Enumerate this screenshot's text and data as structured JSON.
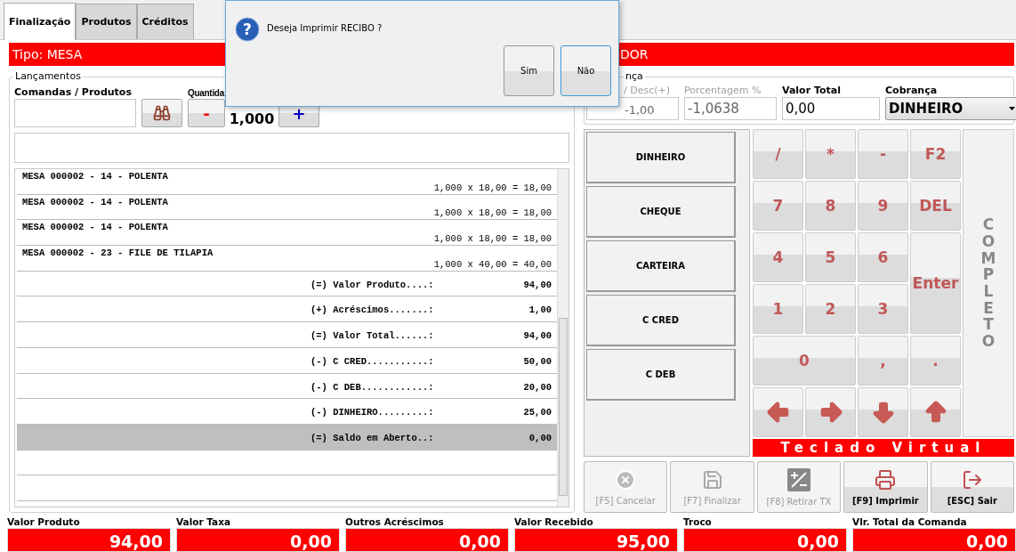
{
  "tabs": [
    {
      "label": "Finalização",
      "selected": true
    },
    {
      "label": "Produtos",
      "selected": false
    },
    {
      "label": "Créditos",
      "selected": false
    }
  ],
  "header": {
    "left": "Tipo: MESA",
    "right": "DOR"
  },
  "launch": {
    "title": "Lançamentos",
    "product_label": "Comandas / Produtos",
    "quantity_label": "Quantida",
    "minus": "-",
    "quantity": "1,000",
    "plus": "+"
  },
  "entries": [
    {
      "kind": "item",
      "title": "MESA 000002 - 14 - POLENTA",
      "calc": "1,000 x 18,00 = 18,00",
      "selected": false
    },
    {
      "kind": "item",
      "title": "MESA 000002 - 14 - POLENTA",
      "calc": "1,000 x 18,00 = 18,00",
      "selected": false
    },
    {
      "kind": "item",
      "title": "MESA 000002 - 14 - POLENTA",
      "calc": "1,000 x 18,00 = 18,00",
      "selected": false
    },
    {
      "kind": "item",
      "title": "MESA 000002 - 23 - FILE DE TILAPIA",
      "calc": "1,000 x 40,00 = 40,00",
      "selected": false
    },
    {
      "kind": "summary",
      "label": "(=) Valor Produto....:",
      "value": "94,00",
      "selected": false
    },
    {
      "kind": "summary",
      "label": "(+) Acréscimos.......:",
      "value": "1,00",
      "selected": false
    },
    {
      "kind": "summary",
      "label": "(=) Valor Total......:",
      "value": "94,00",
      "selected": false
    },
    {
      "kind": "summary",
      "label": "(-) C CRED...........:",
      "value": "50,00",
      "selected": false
    },
    {
      "kind": "summary",
      "label": "(-) C DEB............:",
      "value": "20,00",
      "selected": false
    },
    {
      "kind": "summary",
      "label": "(-) DINHEIRO.........:",
      "value": "25,00",
      "selected": false
    },
    {
      "kind": "summary",
      "label": "(=) Saldo em Aberto..:",
      "value": "0,00",
      "selected": true
    }
  ],
  "billing": {
    "title": "nça",
    "fields": [
      {
        "label": "/ Desc(+)",
        "value": "-1,00",
        "disabled": true
      },
      {
        "label": "Porcentagem %",
        "value": "-1,0638",
        "disabled": true
      },
      {
        "label": "Valor Total",
        "value": "0,00",
        "disabled": false
      }
    ],
    "charge": {
      "label": "Cobrança",
      "value": "DINHEIRO"
    }
  },
  "payment_methods": [
    "DINHEIRO",
    "CHEQUE",
    "CARTEIRA",
    "C CRED",
    "C DEB"
  ],
  "keypad": {
    "keys": [
      {
        "kind": "key",
        "label": "/"
      },
      {
        "kind": "key",
        "label": "*"
      },
      {
        "kind": "key",
        "label": "-"
      },
      {
        "kind": "key",
        "label": "F2"
      },
      {
        "kind": "key",
        "label": "7"
      },
      {
        "kind": "key",
        "label": "8"
      },
      {
        "kind": "key",
        "label": "9"
      },
      {
        "kind": "key",
        "label": "DEL"
      },
      {
        "kind": "key",
        "label": "4"
      },
      {
        "kind": "key",
        "label": "5"
      },
      {
        "kind": "key",
        "label": "6"
      },
      {
        "kind": "tall",
        "label": "Enter"
      },
      {
        "kind": "key",
        "label": "1"
      },
      {
        "kind": "key",
        "label": "2"
      },
      {
        "kind": "key",
        "label": "3"
      },
      {
        "kind": "wide",
        "label": "0"
      },
      {
        "kind": "key",
        "label": ","
      },
      {
        "kind": "key",
        "label": "."
      },
      {
        "kind": "left"
      },
      {
        "kind": "right"
      },
      {
        "kind": "down"
      },
      {
        "kind": "up"
      }
    ],
    "side": "COMPLETO",
    "caption": "Teclado Virtual"
  },
  "actions": [
    {
      "kind": "cancel",
      "label": "[F5] Cancelar",
      "disabled": true
    },
    {
      "kind": "save",
      "label": "[F7] Finalizar",
      "disabled": true
    },
    {
      "kind": "tax",
      "label": "[F8] Retirar TX",
      "disabled": true
    },
    {
      "kind": "print",
      "label": "[F9] Imprimir",
      "disabled": false
    },
    {
      "kind": "exit",
      "label": "[ESC] Sair",
      "disabled": false
    }
  ],
  "totals": [
    {
      "label": "Valor Produto",
      "value": "94,00"
    },
    {
      "label": "Valor Taxa",
      "value": "0,00"
    },
    {
      "label": "Outros Acréscimos",
      "value": "0,00"
    },
    {
      "label": "Valor Recebido",
      "value": "95,00"
    },
    {
      "label": "Troco",
      "value": "0,00"
    },
    {
      "label": "Vlr. Total da Comanda",
      "value": "0,00"
    }
  ],
  "dialog": {
    "icon": "?",
    "message": "Deseja Imprimir RECIBO ?",
    "buttons": [
      {
        "label": "Sim",
        "focused": false
      },
      {
        "label": "Não",
        "focused": true
      }
    ]
  }
}
